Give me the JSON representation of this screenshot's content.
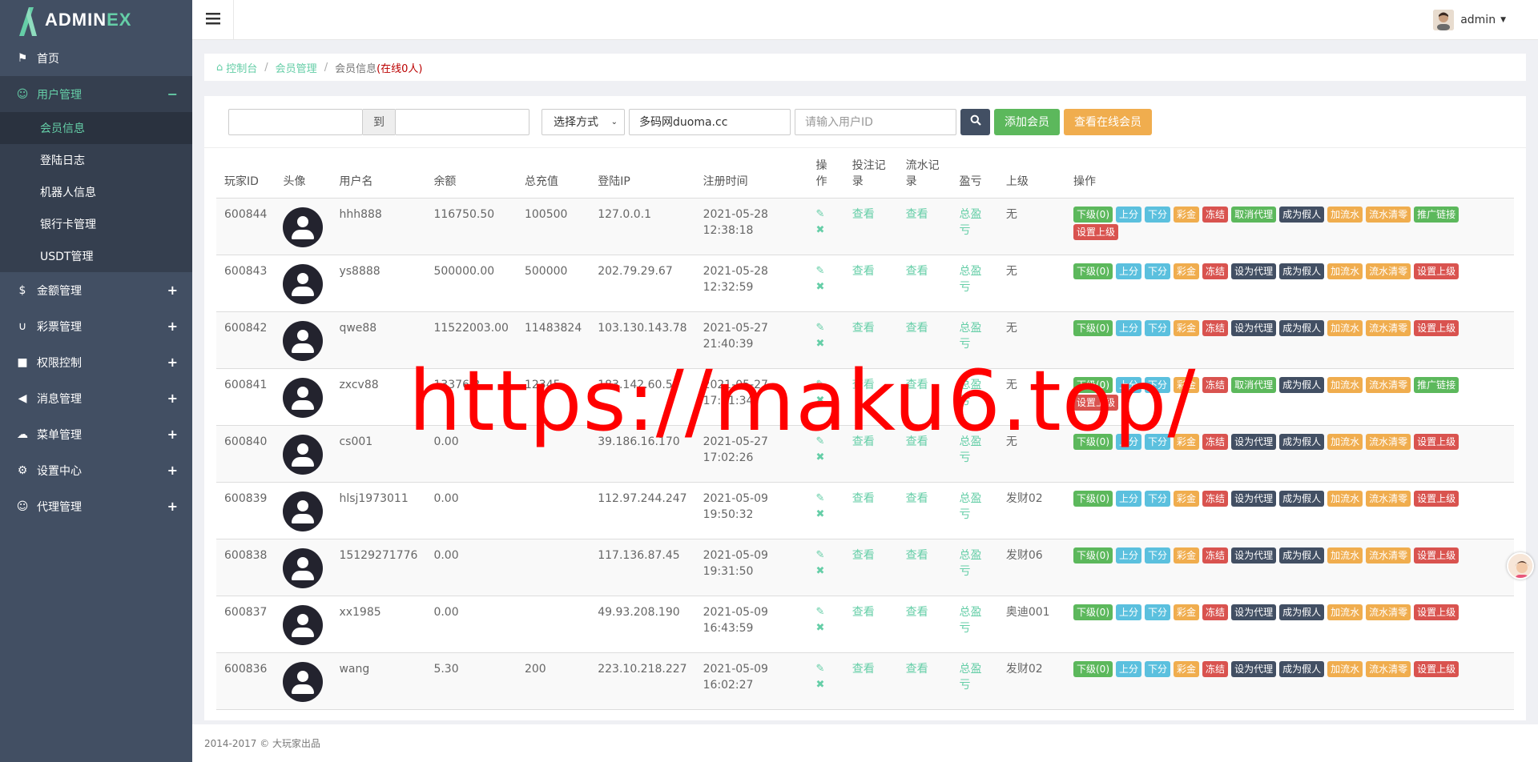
{
  "app": {
    "logo_main": "ADMIN",
    "logo_accent": "EX"
  },
  "sidebar": {
    "items": [
      {
        "label": "首页",
        "icon": "flag-icon",
        "sign": ""
      },
      {
        "label": "用户管理",
        "icon": "smile-icon",
        "sign": "−"
      },
      {
        "label": "金额管理",
        "icon": "dollar-icon",
        "sign": "+"
      },
      {
        "label": "彩票管理",
        "icon": "magnet-icon",
        "sign": "+"
      },
      {
        "label": "权限控制",
        "icon": "lock-icon",
        "sign": "+"
      },
      {
        "label": "消息管理",
        "icon": "bullhorn-icon",
        "sign": "+"
      },
      {
        "label": "菜单管理",
        "icon": "cloud-icon",
        "sign": "+"
      },
      {
        "label": "设置中心",
        "icon": "gear-icon",
        "sign": "+"
      },
      {
        "label": "代理管理",
        "icon": "smile-icon",
        "sign": "+"
      }
    ],
    "sub_items": [
      "会员信息",
      "登陆日志",
      "机器人信息",
      "银行卡管理",
      "USDT管理"
    ]
  },
  "header": {
    "username": "admin"
  },
  "breadcrumb": {
    "home": "控制台",
    "section": "会员管理",
    "current": "会员信息",
    "online": "(在线0人)"
  },
  "filter": {
    "to_label": "到",
    "select_value": "选择方式",
    "text_value": "多码网duoma.cc",
    "id_placeholder": "请输入用户ID",
    "add_button": "添加会员",
    "online_button": "查看在线会员"
  },
  "table": {
    "headers": [
      "玩家ID",
      "头像",
      "用户名",
      "余额",
      "总充值",
      "登陆IP",
      "注册时间",
      "操作",
      "投注记录",
      "流水记录",
      "盈亏",
      "上级",
      "操作"
    ],
    "view_label": "查看",
    "profit_label": "总盈亏",
    "rows": [
      {
        "id": "600844",
        "user": "hhh888",
        "balance": "116750.50",
        "recharge": "100500",
        "ip": "127.0.0.1",
        "date": "2021-05-28",
        "time": "12:38:18",
        "parent": "无",
        "agent": "取消代理",
        "last": "推广链接",
        "extra": "设置上级"
      },
      {
        "id": "600843",
        "user": "ys8888",
        "balance": "500000.00",
        "recharge": "500000",
        "ip": "202.79.29.67",
        "date": "2021-05-28",
        "time": "12:32:59",
        "parent": "无",
        "agent": "设为代理",
        "last": "设置上级",
        "extra": ""
      },
      {
        "id": "600842",
        "user": "qwe88",
        "balance": "11522003.00",
        "recharge": "11483824",
        "ip": "103.130.143.78",
        "date": "2021-05-27",
        "time": "21:40:39",
        "parent": "无",
        "agent": "设为代理",
        "last": "设置上级",
        "extra": ""
      },
      {
        "id": "600841",
        "user": "zxcv88",
        "balance": "13376.2",
        "recharge": "12345",
        "ip": "183.142.60.5",
        "date": "2021-05-27",
        "time": "17:31:34",
        "parent": "无",
        "agent": "取消代理",
        "last": "推广链接",
        "extra": "设置上级"
      },
      {
        "id": "600840",
        "user": "cs001",
        "balance": "0.00",
        "recharge": "",
        "ip": "39.186.16.170",
        "date": "2021-05-27",
        "time": "17:02:26",
        "parent": "无",
        "agent": "设为代理",
        "last": "设置上级",
        "extra": ""
      },
      {
        "id": "600839",
        "user": "hlsj1973011",
        "balance": "0.00",
        "recharge": "",
        "ip": "112.97.244.247",
        "date": "2021-05-09",
        "time": "19:50:32",
        "parent": "发财02",
        "agent": "设为代理",
        "last": "设置上级",
        "extra": ""
      },
      {
        "id": "600838",
        "user": "15129271776",
        "balance": "0.00",
        "recharge": "",
        "ip": "117.136.87.45",
        "date": "2021-05-09",
        "time": "19:31:50",
        "parent": "发财06",
        "agent": "设为代理",
        "last": "设置上级",
        "extra": ""
      },
      {
        "id": "600837",
        "user": "xx1985",
        "balance": "0.00",
        "recharge": "",
        "ip": "49.93.208.190",
        "date": "2021-05-09",
        "time": "16:43:59",
        "parent": "奥迪001",
        "agent": "设为代理",
        "last": "设置上级",
        "extra": ""
      },
      {
        "id": "600836",
        "user": "wang",
        "balance": "5.30",
        "recharge": "200",
        "ip": "223.10.218.227",
        "date": "2021-05-09",
        "time": "16:02:27",
        "parent": "发财02",
        "agent": "设为代理",
        "last": "设置上级",
        "extra": ""
      }
    ],
    "actions": [
      "下级(0)",
      "上分",
      "下分",
      "彩金",
      "冻结",
      "成为假人",
      "加流水",
      "流水清零"
    ]
  },
  "footer": {
    "text": "2014-2017 © 大玩家出品"
  },
  "watermark": {
    "text": "https://maku6.top/"
  }
}
